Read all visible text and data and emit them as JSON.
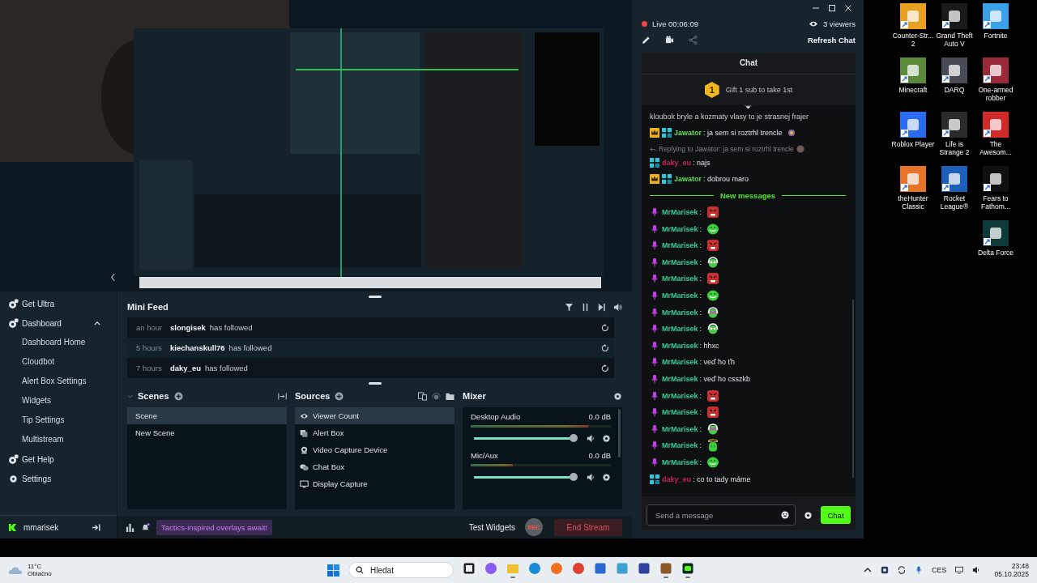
{
  "sidebar": {
    "items": [
      {
        "label": "Get Ultra",
        "kind": "ultra"
      },
      {
        "label": "Dashboard",
        "kind": "dashboard",
        "expanded": true,
        "children": [
          {
            "label": "Dashboard Home"
          },
          {
            "label": "Cloudbot"
          },
          {
            "label": "Alert Box Settings"
          },
          {
            "label": "Widgets"
          },
          {
            "label": "Tip Settings"
          },
          {
            "label": "Multistream"
          }
        ]
      },
      {
        "label": "Get Help",
        "kind": "help"
      },
      {
        "label": "Settings",
        "kind": "settings"
      }
    ],
    "user": "mmarisek"
  },
  "mini_feed": {
    "title": "Mini Feed",
    "events": [
      {
        "time": "an hour",
        "user": "slongisek",
        "action": "has followed"
      },
      {
        "time": "5 hours",
        "user": "kiechanskull76",
        "action": "has followed"
      },
      {
        "time": "7 hours",
        "user": "daky_eu",
        "action": "has followed"
      }
    ]
  },
  "scenes": {
    "title": "Scenes",
    "items": [
      {
        "label": "Scene",
        "selected": true
      },
      {
        "label": "New Scene",
        "selected": false
      }
    ]
  },
  "sources": {
    "title": "Sources",
    "items": [
      {
        "label": "Viewer Count",
        "kind": "eye",
        "selected": true
      },
      {
        "label": "Alert Box",
        "kind": "alert",
        "selected": false
      },
      {
        "label": "Video Capture Device",
        "kind": "webcam",
        "selected": false
      },
      {
        "label": "Chat Box",
        "kind": "chat",
        "selected": false
      },
      {
        "label": "Display Capture",
        "kind": "monitor",
        "selected": false
      }
    ]
  },
  "mixer": {
    "title": "Mixer",
    "channels": [
      {
        "name": "Desktop Audio",
        "reading": "0.0 dB",
        "meter": {
          "level": 0.84
        },
        "volume": {
          "level": 0.97
        }
      },
      {
        "name": "Mic/Aux",
        "reading": "0.0 dB",
        "meter": {
          "level": 0.3
        },
        "volume": {
          "level": 0.97
        }
      }
    ]
  },
  "footer": {
    "promo": "Tactics-inspired overlays await!",
    "test_widgets": "Test Widgets",
    "rec": "REC",
    "end_stream": "End Stream"
  },
  "chat_panel": {
    "live": "Live 00:06:09",
    "viewers": "3 viewers",
    "refresh": "Refresh Chat",
    "title": "Chat",
    "gift_rank": "1",
    "gift_text": "Gift 1 sub to take 1st",
    "messages": [
      {
        "kind": "continuation",
        "text": "kloubok bryle a kozmaty vlasy to je strasnej frajer"
      },
      {
        "kind": "message",
        "badges": [
          {
            "kind": "crown"
          },
          {
            "kind": "og"
          }
        ],
        "user": "Jawator",
        "color": "#62dc57",
        "text": ": ja sem si roztrhl trencle",
        "emote": {
          "kind": "ball"
        }
      },
      {
        "kind": "reply",
        "text": "Replying to Jawator: ja sem si roztrhl trencle"
      },
      {
        "kind": "message",
        "badges": [
          {
            "kind": "og"
          }
        ],
        "user": "daky_eu",
        "color": "#c0265a",
        "text": ": najs"
      },
      {
        "kind": "message",
        "badges": [
          {
            "kind": "crown"
          },
          {
            "kind": "og"
          }
        ],
        "user": "Jawator",
        "color": "#62dc57",
        "text": ": dobrou maro"
      },
      {
        "kind": "divider",
        "text": "New messages"
      },
      {
        "kind": "message",
        "badges": [
          {
            "kind": "mic"
          }
        ],
        "user": "MrMarisek",
        "color": "#2fcf96",
        "text": ":",
        "emote": {
          "kind": "rage"
        }
      },
      {
        "kind": "message",
        "badges": [
          {
            "kind": "mic"
          }
        ],
        "user": "MrMarisek",
        "color": "#2fcf96",
        "text": ":",
        "emote": {
          "kind": "grin"
        }
      },
      {
        "kind": "message",
        "badges": [
          {
            "kind": "mic"
          }
        ],
        "user": "MrMarisek",
        "color": "#2fcf96",
        "text": ":",
        "emote": {
          "kind": "rage"
        }
      },
      {
        "kind": "message",
        "badges": [
          {
            "kind": "mic"
          }
        ],
        "user": "MrMarisek",
        "color": "#2fcf96",
        "text": ":",
        "emote": {
          "kind": "headphones"
        }
      },
      {
        "kind": "message",
        "badges": [
          {
            "kind": "mic"
          }
        ],
        "user": "MrMarisek",
        "color": "#2fcf96",
        "text": ":",
        "emote": {
          "kind": "rage"
        }
      },
      {
        "kind": "message",
        "badges": [
          {
            "kind": "mic"
          }
        ],
        "user": "MrMarisek",
        "color": "#2fcf96",
        "text": ":",
        "emote": {
          "kind": "grin"
        }
      },
      {
        "kind": "message",
        "badges": [
          {
            "kind": "mic"
          }
        ],
        "user": "MrMarisek",
        "color": "#2fcf96",
        "text": ":",
        "emote": {
          "kind": "pink-eyes"
        }
      },
      {
        "kind": "message",
        "badges": [
          {
            "kind": "mic"
          }
        ],
        "user": "MrMarisek",
        "color": "#2fcf96",
        "text": ":",
        "emote": {
          "kind": "headphones"
        }
      },
      {
        "kind": "message",
        "badges": [
          {
            "kind": "mic"
          }
        ],
        "user": "MrMarisek",
        "color": "#2fcf96",
        "text": ": hhxc"
      },
      {
        "kind": "message",
        "badges": [
          {
            "kind": "mic"
          }
        ],
        "user": "MrMarisek",
        "color": "#2fcf96",
        "text": ": veď ho ťh"
      },
      {
        "kind": "message",
        "badges": [
          {
            "kind": "mic"
          }
        ],
        "user": "MrMarisek",
        "color": "#2fcf96",
        "text": ": veď ho csszkb"
      },
      {
        "kind": "message",
        "badges": [
          {
            "kind": "mic"
          }
        ],
        "user": "MrMarisek",
        "color": "#2fcf96",
        "text": ":",
        "emote": {
          "kind": "rage"
        }
      },
      {
        "kind": "message",
        "badges": [
          {
            "kind": "mic"
          }
        ],
        "user": "MrMarisek",
        "color": "#2fcf96",
        "text": ":",
        "emote": {
          "kind": "rage"
        }
      },
      {
        "kind": "message",
        "badges": [
          {
            "kind": "mic"
          }
        ],
        "user": "MrMarisek",
        "color": "#2fcf96",
        "text": ":",
        "emote": {
          "kind": "pink-eyes"
        }
      },
      {
        "kind": "message",
        "badges": [
          {
            "kind": "mic"
          }
        ],
        "user": "MrMarisek",
        "color": "#2fcf96",
        "text": ":",
        "emote": {
          "kind": "halo"
        }
      },
      {
        "kind": "message",
        "badges": [
          {
            "kind": "mic"
          }
        ],
        "user": "MrMarisek",
        "color": "#2fcf96",
        "text": ":",
        "emote": {
          "kind": "grin"
        }
      },
      {
        "kind": "message",
        "badges": [
          {
            "kind": "og"
          }
        ],
        "user": "daky_eu",
        "color": "#c0265a",
        "text": ": co to tady máme"
      }
    ],
    "input_placeholder": "Send a message",
    "send": "Chat"
  },
  "desktop": {
    "columns": [
      [
        {
          "label": "Counter-Str...\n2",
          "color": "#e8a020"
        },
        {
          "label": "Minecraft",
          "color": "#5a8a3a"
        },
        {
          "label": "Roblox Player",
          "color": "#2a6cf0"
        },
        {
          "label": "theHunter\nClassic",
          "color": "#e8742a"
        }
      ],
      [
        {
          "label": "Grand Theft\nAuto V",
          "color": "#1a1a1a"
        },
        {
          "label": "DARQ",
          "color": "#4a4a55"
        },
        {
          "label": "Life is\nStrange 2",
          "color": "#2a2a2a"
        },
        {
          "label": "Rocket\nLeague®",
          "color": "#1e5fb8"
        }
      ],
      [
        {
          "label": "Fortnite",
          "color": "#3aa0e8"
        },
        {
          "label": "One-armed\nrobber",
          "color": "#9a2a3a"
        },
        {
          "label": "The\nAwesom...",
          "color": "#d02a2a"
        },
        {
          "label": "Fears to\nFathom...",
          "color": "#101010"
        },
        {
          "label": "Delta Force",
          "color": "#0f3a3a"
        }
      ]
    ]
  },
  "taskbar": {
    "weather": {
      "temp": "11°C",
      "text": "Oblačno"
    },
    "search_placeholder": "Hledat",
    "apps": [
      {
        "kind": "taskview",
        "running": false
      },
      {
        "kind": "copilot",
        "running": false
      },
      {
        "kind": "folder",
        "running": true
      },
      {
        "kind": "edge",
        "running": false
      },
      {
        "kind": "firefox",
        "running": false
      },
      {
        "kind": "chrome",
        "running": false
      },
      {
        "kind": "store",
        "running": false
      },
      {
        "kind": "photos",
        "running": false
      },
      {
        "kind": "save",
        "running": false
      },
      {
        "kind": "box",
        "running": true
      },
      {
        "kind": "streamlabs",
        "running": true
      }
    ],
    "language": "CES",
    "time": "23:48",
    "date": "05.10.2025"
  }
}
